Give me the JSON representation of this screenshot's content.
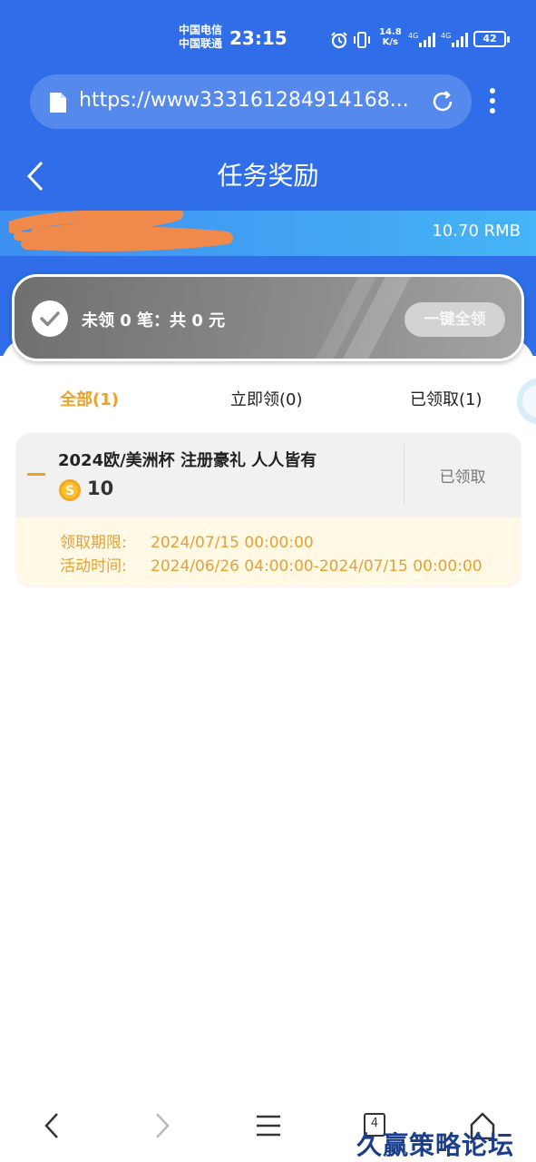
{
  "status_bar": {
    "carrier_1": "中国电信",
    "carrier_2": "中国联通",
    "time": "23:15",
    "net_speed_value": "14.8",
    "net_speed_unit": "K/s",
    "battery": "42",
    "icons": [
      "alarm-icon",
      "vibrate-icon",
      "signal-4g-icon",
      "signal-4g-icon",
      "battery-icon"
    ]
  },
  "browser": {
    "url": "https://www333161284914168...",
    "icons": [
      "file-icon",
      "refresh-icon",
      "more-vertical-icon"
    ]
  },
  "header": {
    "title": "任务奖励",
    "back_icon": "chevron-left-icon"
  },
  "balance": {
    "value": "10.70 RMB"
  },
  "summary": {
    "text": "未领 0 笔：共 0 元",
    "claim_all_label": "一键全领"
  },
  "tabs": [
    {
      "label": "全部(1)",
      "active": true
    },
    {
      "label": "立即领(0)",
      "active": false
    },
    {
      "label": "已领取(1)",
      "active": false
    }
  ],
  "tasks": [
    {
      "title": "2024欧/美洲杯 注册豪礼 人人皆有",
      "reward": "10",
      "status": "已领取",
      "deadline_label": "领取期限:",
      "deadline": "2024/07/15 00:00:00",
      "period_label": "活动时间:",
      "period": "2024/06/26 04:00:00-2024/07/15 00:00:00"
    }
  ],
  "bottom_nav": {
    "tab_count": "4",
    "icons": [
      "back-icon",
      "forward-icon",
      "menu-icon",
      "tabs-icon",
      "home-icon"
    ]
  },
  "watermark": "久赢策略论坛",
  "colors": {
    "primary_blue": "#2f6ee8",
    "accent_orange": "#f0a020",
    "balance_band": "#46b4f6"
  }
}
